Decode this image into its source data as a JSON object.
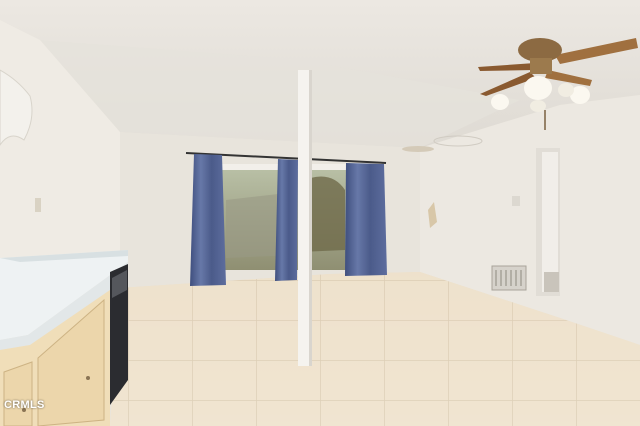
{
  "photo": {
    "credit": "CRMLS"
  }
}
